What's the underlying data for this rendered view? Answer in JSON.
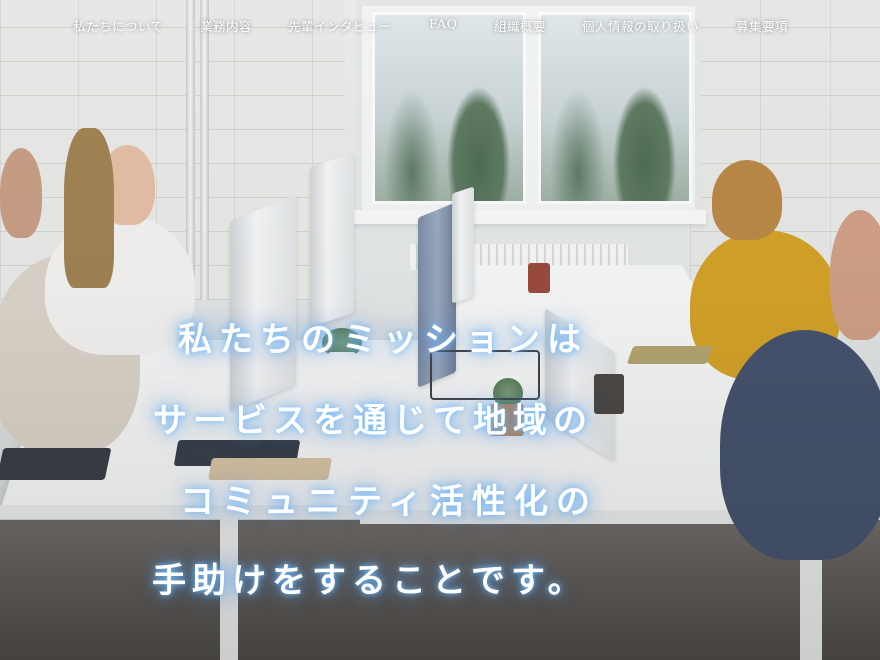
{
  "nav": {
    "items": [
      "私たちについて",
      "業務内容",
      "先輩インタビュー",
      "FAQ",
      "組織概要",
      "個人情報の取り扱い",
      "募集要項"
    ]
  },
  "hero": {
    "mission_lines": [
      "私たちのミッションは",
      "サービスを通じて地域の",
      "コミュニティ活性化の",
      "手助けをすることです。"
    ]
  },
  "colors": {
    "nav_text": "#ffffff",
    "headline_text": "#ffffff",
    "headline_glow": "#78beff"
  }
}
